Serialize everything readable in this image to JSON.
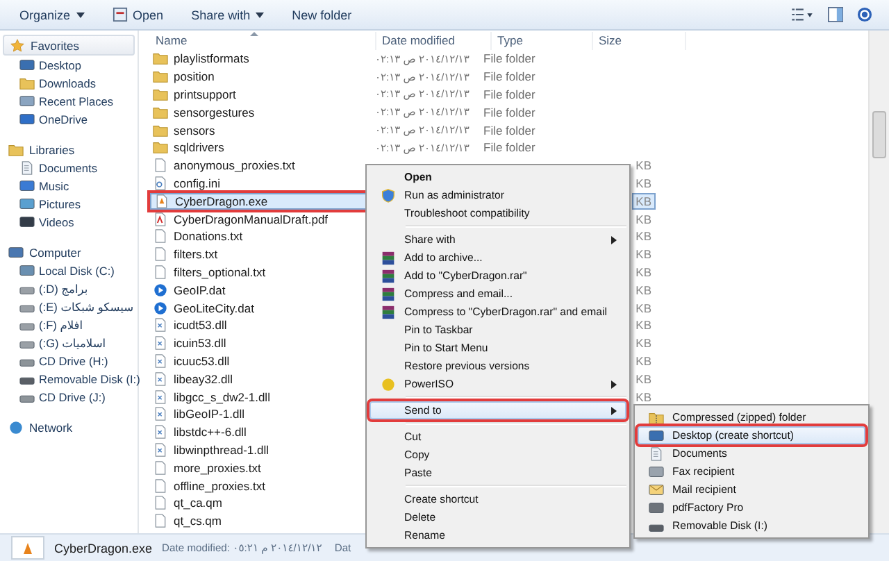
{
  "toolbar": {
    "buttons": [
      {
        "label": "Organize",
        "kind": "dropdown"
      },
      {
        "label": "Open",
        "kind": "icon"
      },
      {
        "label": "Share with",
        "kind": "dropdown"
      },
      {
        "label": "New folder",
        "kind": "plain"
      }
    ]
  },
  "sidebar": {
    "groups": [
      {
        "label": "Favorites",
        "kind": "star",
        "selected": true,
        "children": [
          {
            "label": "Desktop",
            "kind": "desktop",
            "selected": false
          },
          {
            "label": "Downloads",
            "kind": "folder",
            "selected": false
          },
          {
            "label": "Recent Places",
            "kind": "recent",
            "selected": false
          },
          {
            "label": "OneDrive",
            "kind": "cloud",
            "selected": false
          }
        ]
      },
      {
        "label": "Libraries",
        "kind": "library",
        "selected": false,
        "children": [
          {
            "label": "Documents",
            "kind": "doc",
            "selected": false
          },
          {
            "label": "Music",
            "kind": "music",
            "selected": false
          },
          {
            "label": "Pictures",
            "kind": "picture",
            "selected": false
          },
          {
            "label": "Videos",
            "kind": "video",
            "selected": false
          }
        ]
      },
      {
        "label": "Computer",
        "kind": "computer",
        "selected": false,
        "children": [
          {
            "label": "Local Disk (C:)",
            "kind": "system",
            "selected": false
          },
          {
            "label": "برامج (D:)",
            "kind": "drive",
            "selected": false
          },
          {
            "label": "سيسكو شبكات (E:)",
            "kind": "drive",
            "selected": false
          },
          {
            "label": "افلام (F:)",
            "kind": "drive",
            "selected": false
          },
          {
            "label": "اسلاميات (G:)",
            "kind": "drive",
            "selected": false
          },
          {
            "label": "CD Drive (H:)",
            "kind": "cd",
            "selected": false
          },
          {
            "label": "Removable Disk (I:)",
            "kind": "removable",
            "selected": false
          },
          {
            "label": "CD Drive (J:)",
            "kind": "cd",
            "selected": false
          }
        ]
      },
      {
        "label": "Network",
        "kind": "network",
        "selected": false
      }
    ]
  },
  "columns": [
    {
      "label": "Name",
      "sorted": true
    },
    {
      "label": "Date modified",
      "sorted": false
    },
    {
      "label": "Type",
      "sorted": false
    },
    {
      "label": "Size",
      "sorted": false
    }
  ],
  "files": [
    {
      "name": "playlistformats",
      "kind": "folder",
      "date": "٢٠١٤/١٢/١٣ ص ٠٢:١٣",
      "type": "File folder",
      "selected": false,
      "marked": false
    },
    {
      "name": "position",
      "kind": "folder",
      "date": "٢٠١٤/١٢/١٣ ص ٠٢:١٣",
      "type": "File folder",
      "selected": false,
      "marked": false
    },
    {
      "name": "printsupport",
      "kind": "folder",
      "date": "٢٠١٤/١٢/١٣ ص ٠٢:١٣",
      "type": "File folder",
      "selected": false,
      "marked": false
    },
    {
      "name": "sensorgestures",
      "kind": "folder",
      "date": "٢٠١٤/١٢/١٣ ص ٠٢:١٣",
      "type": "File folder",
      "selected": false,
      "marked": false
    },
    {
      "name": "sensors",
      "kind": "folder",
      "date": "٢٠١٤/١٢/١٣ ص ٠٢:١٣",
      "type": "File folder",
      "selected": false,
      "marked": false
    },
    {
      "name": "sqldrivers",
      "kind": "folder",
      "date": "٢٠١٤/١٢/١٣ ص ٠٢:١٣",
      "type": "File folder",
      "selected": false,
      "marked": false
    },
    {
      "name": "anonymous_proxies.txt",
      "kind": "text",
      "size": "KB",
      "selected": false,
      "marked": false
    },
    {
      "name": "config.ini",
      "kind": "settings",
      "size": "KB",
      "selected": false,
      "marked": false
    },
    {
      "name": "CyberDragon.exe",
      "kind": "app",
      "size": "KB",
      "selected": true,
      "marked": true
    },
    {
      "name": "CyberDragonManualDraft.pdf",
      "kind": "pdf",
      "size": "KB",
      "selected": false,
      "marked": false
    },
    {
      "name": "Donations.txt",
      "kind": "text",
      "size": "KB",
      "selected": false,
      "marked": false
    },
    {
      "name": "filters.txt",
      "kind": "text",
      "size": "KB",
      "selected": false,
      "marked": false
    },
    {
      "name": "filters_optional.txt",
      "kind": "text",
      "size": "KB",
      "selected": false,
      "marked": false
    },
    {
      "name": "GeoIP.dat",
      "kind": "media",
      "size": "KB",
      "selected": false,
      "marked": false
    },
    {
      "name": "GeoLiteCity.dat",
      "kind": "media",
      "size": "KB",
      "selected": false,
      "marked": false
    },
    {
      "name": "icudt53.dll",
      "kind": "library",
      "size": "KB",
      "selected": false,
      "marked": false
    },
    {
      "name": "icuin53.dll",
      "kind": "library",
      "size": "KB",
      "selected": false,
      "marked": false
    },
    {
      "name": "icuuc53.dll",
      "kind": "library",
      "size": "KB",
      "selected": false,
      "marked": false
    },
    {
      "name": "libeay32.dll",
      "kind": "library",
      "size": "KB",
      "selected": false,
      "marked": false
    },
    {
      "name": "libgcc_s_dw2-1.dll",
      "kind": "library",
      "size": "KB",
      "selected": false,
      "marked": false
    },
    {
      "name": "libGeoIP-1.dll",
      "kind": "library",
      "selected": false,
      "marked": false
    },
    {
      "name": "libstdc++-6.dll",
      "kind": "library",
      "selected": false,
      "marked": false
    },
    {
      "name": "libwinpthread-1.dll",
      "kind": "library",
      "selected": false,
      "marked": false
    },
    {
      "name": "more_proxies.txt",
      "kind": "text",
      "selected": false,
      "marked": false
    },
    {
      "name": "offline_proxies.txt",
      "kind": "text",
      "selected": false,
      "marked": false
    },
    {
      "name": "qt_ca.qm",
      "kind": "blank",
      "selected": false,
      "marked": false
    },
    {
      "name": "qt_cs.qm",
      "kind": "blank",
      "selected": false,
      "marked": false
    }
  ],
  "context_menu": {
    "groups": [
      [
        {
          "label": "Open",
          "kind": "default",
          "submenu": false,
          "selected": false,
          "marked": false
        },
        {
          "label": "Run as administrator",
          "kind": "shield",
          "submenu": false,
          "selected": false,
          "marked": false
        },
        {
          "label": "Troubleshoot compatibility",
          "kind": "plain",
          "submenu": false,
          "selected": false,
          "marked": false
        }
      ],
      [
        {
          "label": "Share with",
          "kind": "plain",
          "submenu": true,
          "selected": false,
          "marked": false
        },
        {
          "label": "Add to archive...",
          "kind": "archive",
          "submenu": false,
          "selected": false,
          "marked": false
        },
        {
          "label": "Add to \"CyberDragon.rar\"",
          "kind": "archive",
          "submenu": false,
          "selected": false,
          "marked": false
        },
        {
          "label": "Compress and email...",
          "kind": "archive",
          "submenu": false,
          "selected": false,
          "marked": false
        },
        {
          "label": "Compress to \"CyberDragon.rar\" and email",
          "kind": "archive",
          "submenu": false,
          "selected": false,
          "marked": false
        },
        {
          "label": "Pin to Taskbar",
          "kind": "plain",
          "submenu": false,
          "selected": false,
          "marked": false
        },
        {
          "label": "Pin to Start Menu",
          "kind": "plain",
          "submenu": false,
          "selected": false,
          "marked": false
        },
        {
          "label": "Restore previous versions",
          "kind": "plain",
          "submenu": false,
          "selected": false,
          "marked": false
        },
        {
          "label": "PowerISO",
          "kind": "disc",
          "submenu": true,
          "selected": false,
          "marked": false
        }
      ],
      [
        {
          "label": "Send to",
          "kind": "plain",
          "submenu": true,
          "selected": true,
          "marked": true
        }
      ],
      [
        {
          "label": "Cut",
          "kind": "plain",
          "submenu": false,
          "selected": false,
          "marked": false
        },
        {
          "label": "Copy",
          "kind": "plain",
          "submenu": false,
          "selected": false,
          "marked": false
        },
        {
          "label": "Paste",
          "kind": "plain",
          "submenu": false,
          "selected": false,
          "marked": false
        }
      ],
      [
        {
          "label": "Create shortcut",
          "kind": "plain",
          "submenu": false,
          "selected": false,
          "marked": false
        },
        {
          "label": "Delete",
          "kind": "plain",
          "submenu": false,
          "selected": false,
          "marked": false
        },
        {
          "label": "Rename",
          "kind": "plain",
          "submenu": false,
          "selected": false,
          "marked": false
        }
      ]
    ]
  },
  "send_to_menu": {
    "items": [
      {
        "label": "Compressed (zipped) folder",
        "kind": "zip",
        "selected": false,
        "marked": false
      },
      {
        "label": "Desktop (create shortcut)",
        "kind": "desktop",
        "selected": true,
        "marked": true
      },
      {
        "label": "Documents",
        "kind": "doc",
        "selected": false,
        "marked": false
      },
      {
        "label": "Fax recipient",
        "kind": "fax",
        "selected": false,
        "marked": false
      },
      {
        "label": "Mail recipient",
        "kind": "mail",
        "selected": false,
        "marked": false
      },
      {
        "label": "pdfFactory Pro",
        "kind": "printer",
        "selected": false,
        "marked": false
      },
      {
        "label": "Removable Disk (I:)",
        "kind": "removable",
        "selected": false,
        "marked": false
      }
    ]
  },
  "status_bar": {
    "name": "CyberDragon.exe",
    "details": "Date modified: ٢٠١٤/١٢/١٢ م ٠٥:٢١",
    "field_2": "Dat"
  }
}
